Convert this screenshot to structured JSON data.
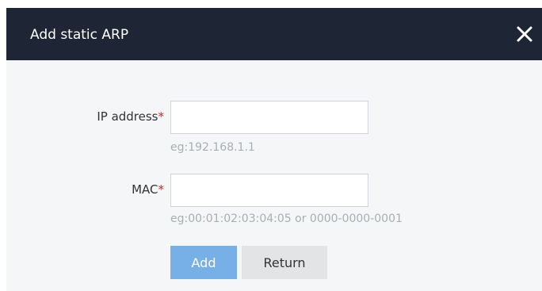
{
  "dialog": {
    "title": "Add static ARP",
    "close_icon": "close-icon"
  },
  "form": {
    "ip": {
      "label": "IP address",
      "required_mark": "*",
      "value": "",
      "hint": "eg:192.168.1.1"
    },
    "mac": {
      "label": "MAC",
      "required_mark": "*",
      "value": "",
      "hint": "eg:00:01:02:03:04:05 or 0000-0000-0001"
    }
  },
  "buttons": {
    "add_label": "Add",
    "return_label": "Return"
  },
  "colors": {
    "titlebar": "#1e2636",
    "required": "#e02020",
    "add_button": "#77b0e6",
    "return_button": "#e3e4e6"
  }
}
